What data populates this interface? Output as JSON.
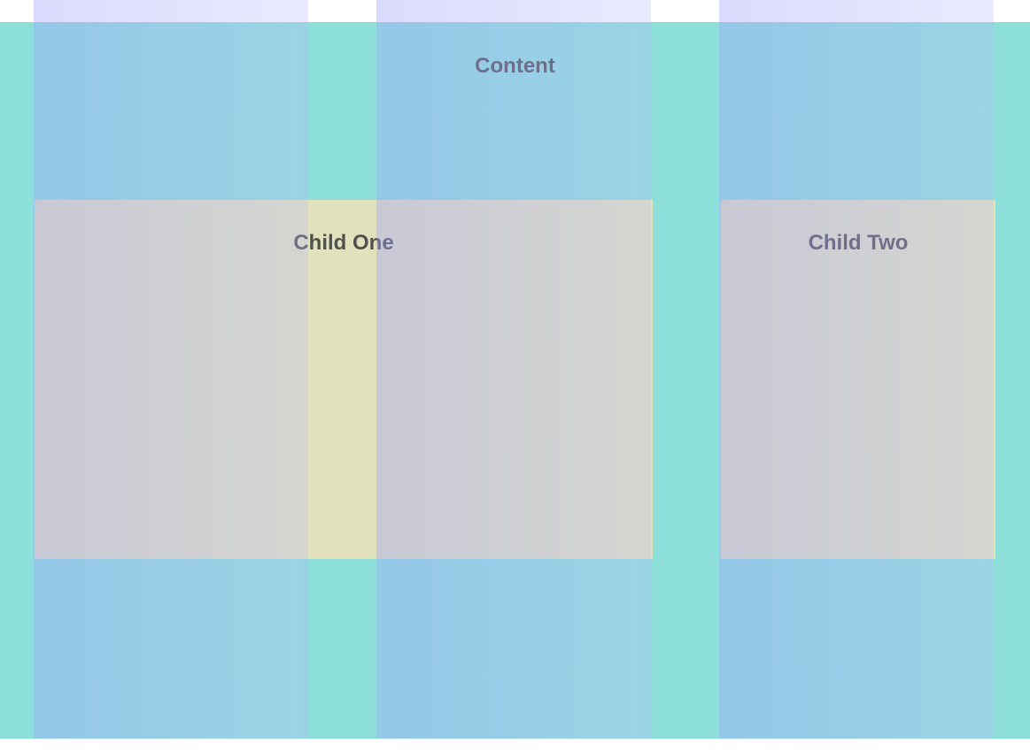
{
  "content": {
    "title": "Content"
  },
  "children": [
    {
      "title": "Child One"
    },
    {
      "title": "Child Two"
    }
  ],
  "grid": {
    "columns": 3
  },
  "colors": {
    "content_background": "#8de0d9",
    "child_background": "#e1e2bc",
    "grid_overlay": "#a0a0ff",
    "text": "#505050"
  }
}
